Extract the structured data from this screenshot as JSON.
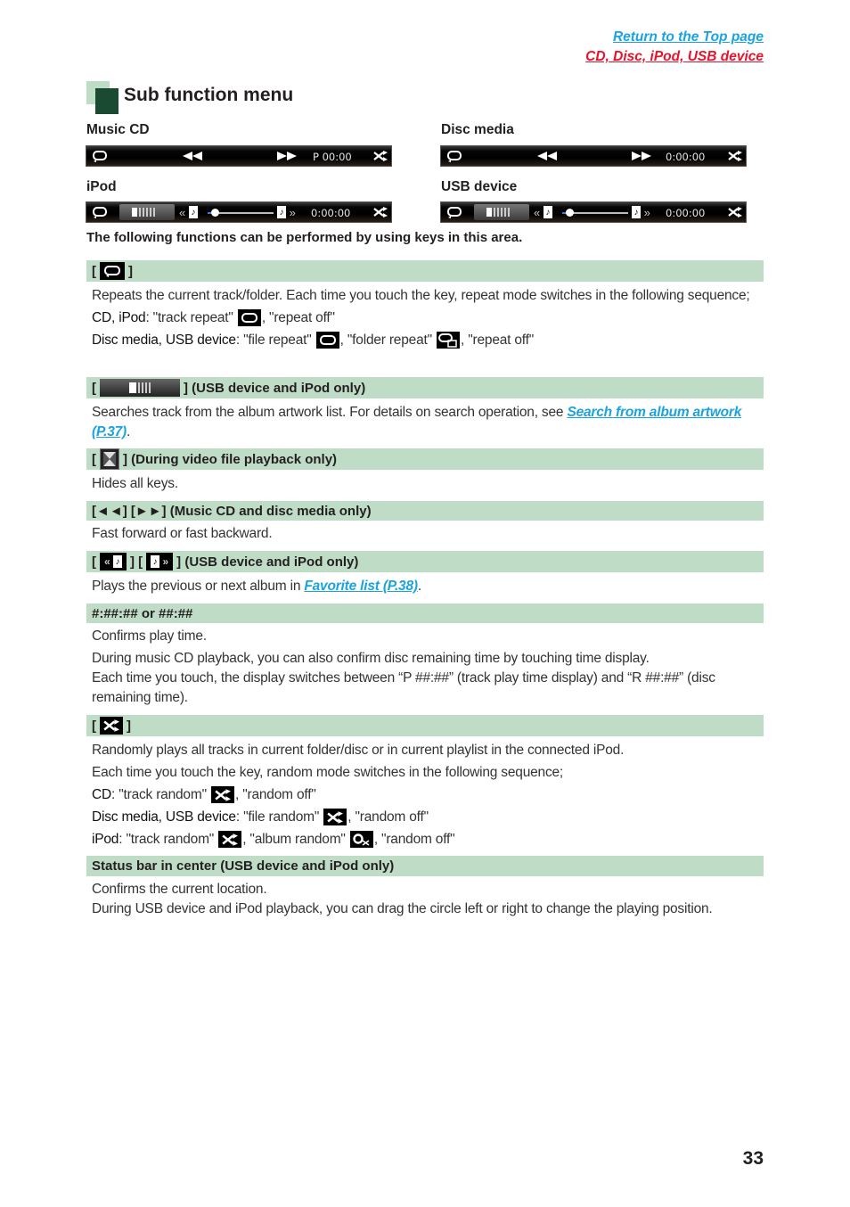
{
  "nav": {
    "return_top": "Return to the Top page",
    "section_link": "CD, Disc, iPod, USB device"
  },
  "title": "Sub function menu",
  "devices": {
    "music_cd": {
      "label": "Music CD",
      "time": "P 00:00"
    },
    "disc_media": {
      "label": "Disc media",
      "time": "0:00:00"
    },
    "ipod": {
      "label": "iPod",
      "time": "0:00:00"
    },
    "usb": {
      "label": "USB device",
      "time": "0:00:00"
    }
  },
  "slider_progress": 0.08,
  "intro": "The following functions can be performed by using keys in this area.",
  "sections": {
    "repeat": {
      "header_open": "[",
      "header_close": "]",
      "text1": "Repeats the current track/folder. Each time you touch the key, repeat mode switches in the following sequence;",
      "cd_label": "CD, iPod",
      "cd_a": ": \"track repeat\"",
      "cd_b": ", \"repeat off\"",
      "disc_label": "Disc media, USB device",
      "disc_a": ": \"file repeat\"",
      "disc_b": ", \"folder repeat\"",
      "disc_c": ", \"repeat off\""
    },
    "artwork": {
      "header_suffix": "] (USB device and iPod only)",
      "text": "Searches track from the album artwork list. For details on search operation, see ",
      "link": "Search from album artwork (P.37)",
      "end": "."
    },
    "hide": {
      "header_suffix": "] (During video file playback only)",
      "text": "Hides all keys."
    },
    "seek": {
      "header": "[◄◄] [►►] (Music CD and disc media only)",
      "text": "Fast forward or fast backward."
    },
    "album": {
      "header_mid": "] [",
      "header_suffix": "] (USB device and iPod only)",
      "text": "Plays the previous or next album in ",
      "link": "Favorite list (P.38)",
      "end": "."
    },
    "time": {
      "header": "#:##:## or ##:##",
      "text1": "Confirms play time.",
      "text2": "During music CD playback, you can also confirm disc remaining time by touching time display.",
      "text3": "Each time you touch, the display switches between “P ##:##” (track play time display) and “R ##:##” (disc remaining time)."
    },
    "random": {
      "text1": "Randomly plays all tracks in current folder/disc or in current playlist in the connected iPod.",
      "text2": "Each time you touch the key, random mode switches in the following sequence;",
      "cd_label": "CD",
      "cd_a": ": \"track random\"",
      "cd_b": ", \"random off\"",
      "disc_label": "Disc media, USB device",
      "disc_a": ": \"file random\"",
      "disc_b": ", \"random off\"",
      "ipod_label": "iPod",
      "ipod_a": ": \"track random\"",
      "ipod_b": ", \"album random\"",
      "ipod_c": ", \"random off\""
    },
    "status": {
      "header": "Status bar in center (USB device and iPod only)",
      "text1": "Confirms the current location.",
      "text2": "During USB device and iPod playback, you can drag the circle left or right to change the playing position."
    }
  },
  "page_number": "33"
}
